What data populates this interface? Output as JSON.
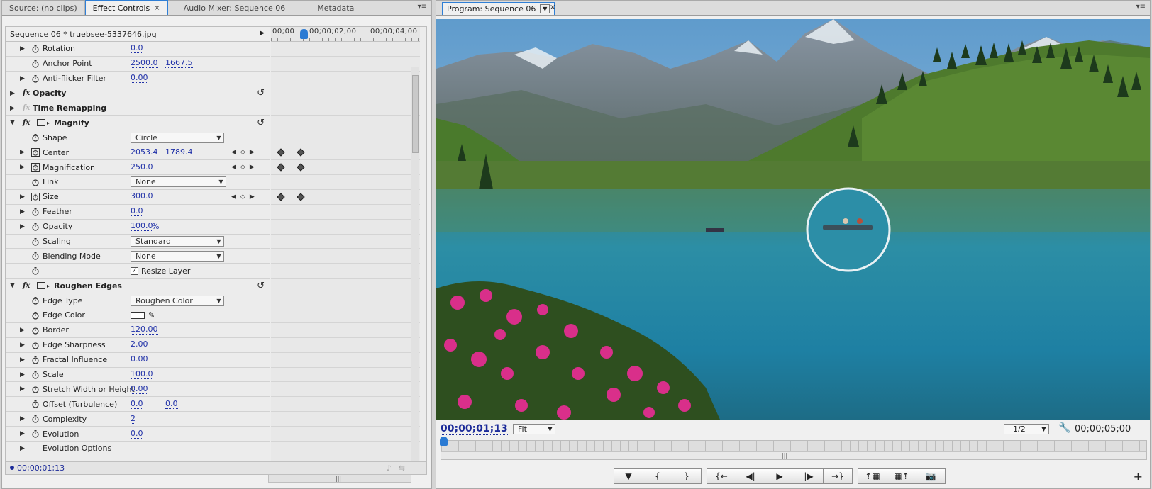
{
  "left_tabs": [
    {
      "label": "Source: (no clips)"
    },
    {
      "label": "Effect Controls"
    },
    {
      "label": "Audio Mixer: Sequence 06"
    },
    {
      "label": "Metadata"
    }
  ],
  "panel_menu_glyph": "▾≡",
  "close_glyph": "×",
  "effect_controls": {
    "clip_title": "Sequence 06 * truebsee-5337646.jpg",
    "ruler": [
      "00;00",
      "00;00;02;00",
      "00;00;04;00"
    ],
    "current_time": "00;00;01;13"
  },
  "rows": {
    "rotation": {
      "label": "Rotation",
      "v1": "0.0"
    },
    "anchor": {
      "label": "Anchor Point",
      "v1": "2500.0",
      "v2": "1667.5"
    },
    "antiflicker": {
      "label": "Anti-flicker Filter",
      "v1": "0.00"
    },
    "opacity_fx": {
      "label": "Opacity"
    },
    "time_remap": {
      "label": "Time Remapping"
    },
    "magnify": {
      "label": "Magnify"
    },
    "shape": {
      "label": "Shape",
      "value": "Circle"
    },
    "center": {
      "label": "Center",
      "v1": "2053.4",
      "v2": "1789.4"
    },
    "magnification": {
      "label": "Magnification",
      "v1": "250.0"
    },
    "link": {
      "label": "Link",
      "value": "None"
    },
    "size": {
      "label": "Size",
      "v1": "300.0"
    },
    "feather": {
      "label": "Feather",
      "v1": "0.0"
    },
    "mag_opacity": {
      "label": "Opacity",
      "v1": "100.0",
      "unit": "%"
    },
    "scaling": {
      "label": "Scaling",
      "value": "Standard"
    },
    "blending": {
      "label": "Blending Mode",
      "value": "None"
    },
    "resize": {
      "label": "Resize Layer",
      "checked": true
    },
    "roughen": {
      "label": "Roughen Edges"
    },
    "edge_type": {
      "label": "Edge Type",
      "value": "Roughen Color"
    },
    "edge_color": {
      "label": "Edge Color",
      "color": "#ffffff"
    },
    "border": {
      "label": "Border",
      "v1": "120.00"
    },
    "edge_sharpness": {
      "label": "Edge Sharpness",
      "v1": "2.00"
    },
    "fractal": {
      "label": "Fractal Influence",
      "v1": "0.00"
    },
    "scale": {
      "label": "Scale",
      "v1": "100.0"
    },
    "stretch": {
      "label": "Stretch Width or Height",
      "v1": "0.00"
    },
    "offset": {
      "label": "Offset (Turbulence)",
      "v1": "0.0",
      "v2": "0.0"
    },
    "complexity": {
      "label": "Complexity",
      "v1": "2"
    },
    "evolution": {
      "label": "Evolution",
      "v1": "0.0"
    },
    "evolution_options": {
      "label": "Evolution Options"
    }
  },
  "program": {
    "tab_label": "Program: Sequence 06",
    "current_time": "00;00;01;13",
    "zoom": "Fit",
    "resolution": "1/2",
    "duration": "00;00;05;00"
  },
  "colors": {
    "accent": "#2f7fd6",
    "timecode": "#1c2b99",
    "value_link": "#2031a8",
    "playhead": "#d93a3a"
  },
  "icons": [
    "stopwatch-icon",
    "fx-icon",
    "mask-rect-icon",
    "reset-icon",
    "eyedropper-icon",
    "wrench-icon",
    "marker-icon",
    "play-icon",
    "camera-icon"
  ]
}
